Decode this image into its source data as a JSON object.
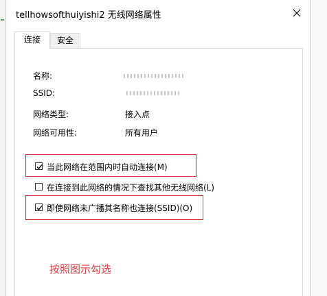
{
  "window": {
    "title": "tellhowsofthuiyishi2 无线网络属性"
  },
  "tabs": [
    {
      "label": "连接",
      "active": true
    },
    {
      "label": "安全",
      "active": false
    }
  ],
  "properties": [
    {
      "label": "名称:",
      "value": ""
    },
    {
      "label": "SSID:",
      "value": ""
    },
    {
      "label": "网络类型:",
      "value": "接入点"
    },
    {
      "label": "网络可用性:",
      "value": "所有用户"
    }
  ],
  "options": [
    {
      "label": "当此网络在范围内时自动连接(M)",
      "checked": true,
      "highlighted": true
    },
    {
      "label": "在连接到此网络的情况下查找其他无线网络(L)",
      "checked": false,
      "highlighted": false
    },
    {
      "label": "即使网络未广播其名称也连接(SSID)(O)",
      "checked": true,
      "highlighted": true
    }
  ],
  "annotation": {
    "text": "按照图示勾选",
    "color": "#d93c3c"
  },
  "colors": {
    "highlight_border": "#d22d2d"
  }
}
